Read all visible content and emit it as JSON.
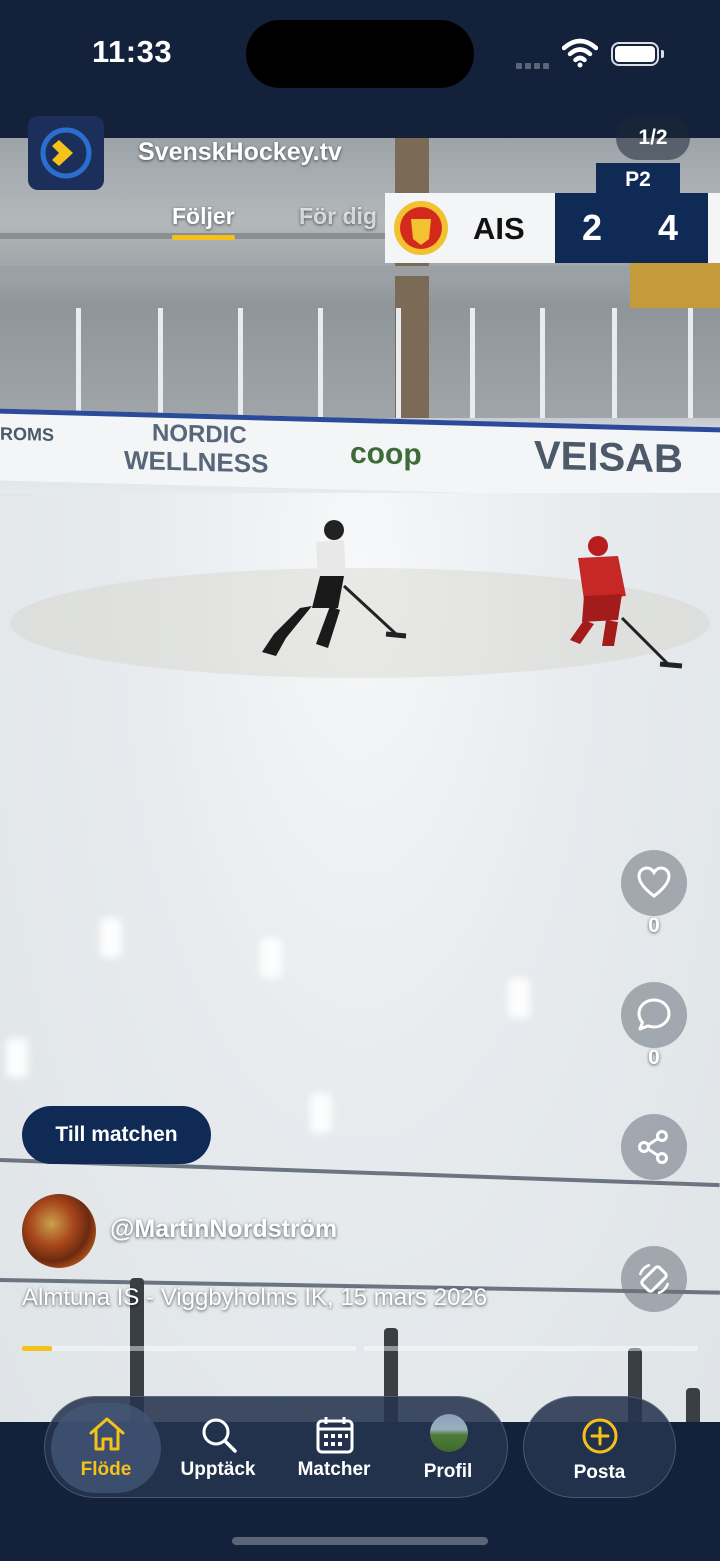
{
  "status_bar": {
    "time": "11:33"
  },
  "header": {
    "app_name": "SvenskHockey.tv",
    "tabs": [
      {
        "label": "Följer",
        "active": true
      },
      {
        "label": "För dig",
        "active": false
      }
    ],
    "page_counter": "1/2"
  },
  "scoreboard": {
    "period": "P2",
    "team": "AIS",
    "home_score": "2",
    "away_score": "4"
  },
  "arena_ads": [
    "ROMS",
    "NORDIC",
    "WELLNESS",
    "coop",
    "VEISAB"
  ],
  "actions": {
    "like_count": "0",
    "comment_count": "0",
    "icons": [
      "heart-icon",
      "comment-icon",
      "share-icon",
      "rotate-icon"
    ]
  },
  "post": {
    "match_button": "Till matchen",
    "username": "@MartinNordström",
    "caption": "Almtuna IS - Viggbyholms IK, 15 mars 2026",
    "progress_segments": 2,
    "progress_current_fraction": 0.09
  },
  "nav": {
    "items": [
      {
        "label": "Flöde",
        "icon": "home-icon",
        "active": true
      },
      {
        "label": "Upptäck",
        "icon": "search-icon",
        "active": false
      },
      {
        "label": "Matcher",
        "icon": "calendar-icon",
        "active": false
      },
      {
        "label": "Profil",
        "icon": "profile-avatar",
        "active": false
      }
    ],
    "post_button": {
      "label": "Posta",
      "icon": "plus-circle-icon"
    }
  },
  "colors": {
    "accent": "#f6c21a",
    "navy": "#0f2a55",
    "background": "#13213a"
  }
}
